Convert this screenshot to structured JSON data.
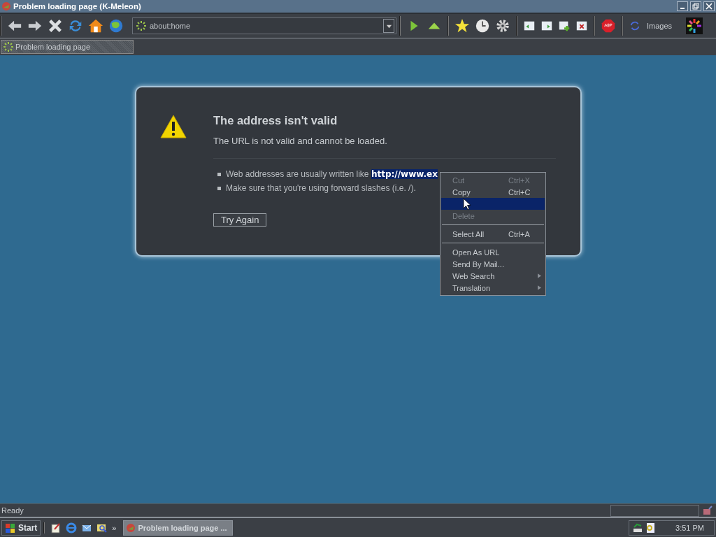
{
  "window": {
    "title": "Problem loading page (K-Meleon)"
  },
  "toolbar": {
    "address": "about:home",
    "images_label": "Images"
  },
  "tabs": [
    {
      "label": "Problem loading page",
      "selected": true
    }
  ],
  "error": {
    "title": "The address isn't valid",
    "message": "The URL is not valid and cannot be loaded.",
    "hints": [
      "Web addresses are usually written like **http://www.ex**",
      "Make sure that you're using forward slashes (i.e. /)."
    ],
    "button": "Try Again"
  },
  "context_menu": [
    {
      "kind": "item",
      "label": "Cut",
      "shortcut": "Ctrl+X",
      "disabled": true,
      "selected": false,
      "submenu": false
    },
    {
      "kind": "item",
      "label": "Copy",
      "shortcut": "Ctrl+C",
      "disabled": false,
      "selected": false,
      "submenu": false
    },
    {
      "kind": "item",
      "disabled": false,
      "selected": true,
      "submenu": false
    },
    {
      "kind": "item",
      "label": "Delete",
      "disabled": true,
      "selected": false,
      "submenu": false
    },
    {
      "kind": "separator"
    },
    {
      "kind": "item",
      "label": "Select All",
      "shortcut": "Ctrl+A",
      "disabled": false,
      "selected": false,
      "submenu": false
    },
    {
      "kind": "separator"
    },
    {
      "kind": "item",
      "label": "Open As URL",
      "disabled": false,
      "selected": false,
      "submenu": false
    },
    {
      "kind": "item",
      "label": "Send By Mail...",
      "disabled": false,
      "selected": false,
      "submenu": false
    },
    {
      "kind": "item",
      "label": "Web Search",
      "disabled": false,
      "selected": false,
      "submenu": true
    },
    {
      "kind": "item",
      "label": "Translation",
      "disabled": false,
      "selected": false,
      "submenu": true
    }
  ],
  "status_bar": {
    "text": "Ready"
  },
  "taskbar": {
    "start": "Start",
    "more": "»",
    "tasks": [
      {
        "label": "Problem loading page ...",
        "selected": true
      }
    ],
    "clock": "3:51 PM"
  }
}
